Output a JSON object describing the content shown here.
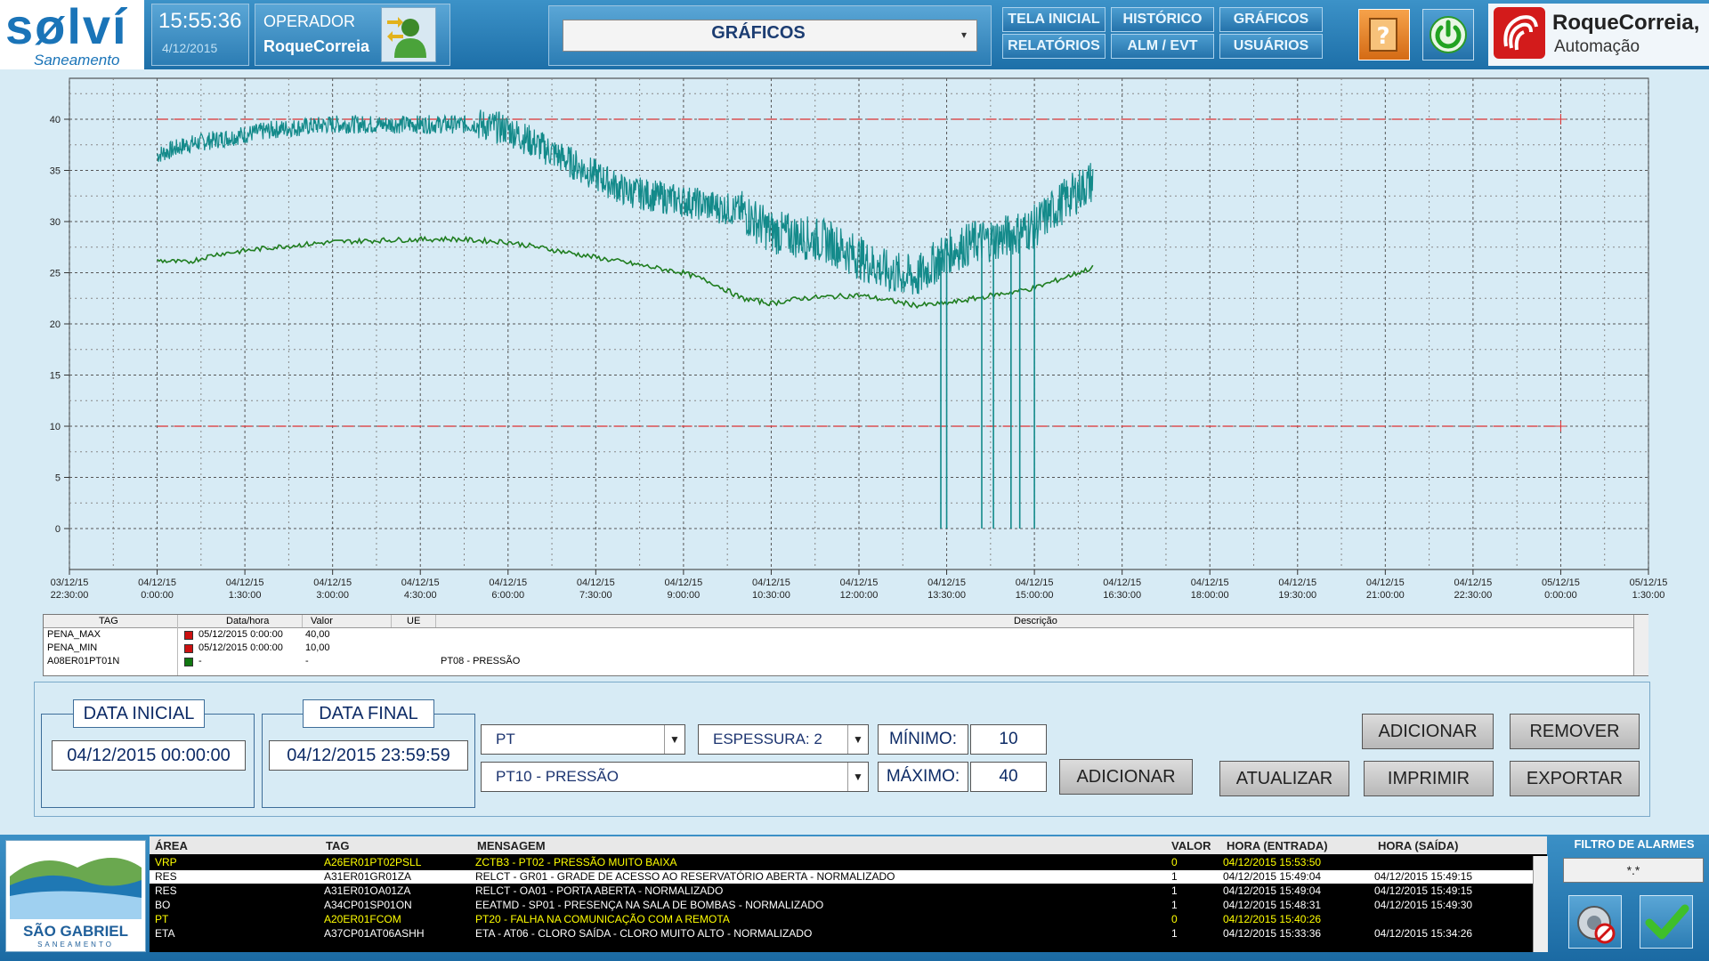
{
  "header": {
    "logo_text": "sølví",
    "logo_sub": "Saneamento",
    "clock": "15:55:36",
    "date_small": "4/12/2015",
    "operator_label": "OPERADOR",
    "operator_name": "RoqueCorreia",
    "screen_title": "GRÁFICOS",
    "nav": [
      "TELA INICIAL",
      "HISTÓRICO",
      "GRÁFICOS",
      "RELATÓRIOS",
      "ALM / EVT",
      "USUÁRIOS"
    ],
    "brand_name": "RoqueCorreia,",
    "brand_sub": "Automação",
    "icons": {
      "operator": "user-switch-icon",
      "help": "help-book-icon",
      "power": "power-icon"
    }
  },
  "chart_data": {
    "type": "line",
    "y_ticks": [
      "0",
      "5",
      "10",
      "15",
      "20",
      "25",
      "30",
      "35",
      "40"
    ],
    "ylim": [
      -4,
      44
    ],
    "x_ticks": [
      [
        "03/12/15",
        "22:30:00"
      ],
      [
        "04/12/15",
        "0:00:00"
      ],
      [
        "04/12/15",
        "1:30:00"
      ],
      [
        "04/12/15",
        "3:00:00"
      ],
      [
        "04/12/15",
        "4:30:00"
      ],
      [
        "04/12/15",
        "6:00:00"
      ],
      [
        "04/12/15",
        "7:30:00"
      ],
      [
        "04/12/15",
        "9:00:00"
      ],
      [
        "04/12/15",
        "10:30:00"
      ],
      [
        "04/12/15",
        "12:00:00"
      ],
      [
        "04/12/15",
        "13:30:00"
      ],
      [
        "04/12/15",
        "15:00:00"
      ],
      [
        "04/12/15",
        "16:30:00"
      ],
      [
        "04/12/15",
        "18:00:00"
      ],
      [
        "04/12/15",
        "19:30:00"
      ],
      [
        "04/12/15",
        "21:00:00"
      ],
      [
        "04/12/15",
        "22:30:00"
      ],
      [
        "05/12/15",
        "0:00:00"
      ],
      [
        "05/12/15",
        "1:30:00"
      ]
    ],
    "xlim_hours": [
      -1.5,
      25.5
    ],
    "grid": true,
    "series": [
      {
        "name": "PENA_MAX",
        "color": "#e03030",
        "style": "dashed",
        "x": [
          0,
          24
        ],
        "y": [
          40,
          40
        ]
      },
      {
        "name": "PENA_MIN",
        "color": "#e03030",
        "style": "dashed",
        "x": [
          0,
          24
        ],
        "y": [
          10,
          10
        ]
      },
      {
        "color": "#138a8a",
        "style": "noisy",
        "x": [
          0,
          0.5,
          1,
          2,
          3,
          4,
          5,
          5.5,
          6,
          6.5,
          7,
          7.5,
          8,
          9,
          10,
          10.5,
          11,
          11.5,
          12,
          12.5,
          13,
          13.5,
          14,
          14.5,
          15,
          15.5,
          16
        ],
        "y": [
          36.5,
          37.5,
          38,
          39,
          39.5,
          39.5,
          39.5,
          39.5,
          39,
          37.5,
          36,
          34.5,
          33,
          32,
          31,
          29,
          28.5,
          28,
          26.5,
          25,
          24.5,
          27,
          28,
          28.5,
          29.5,
          32,
          34
        ]
      },
      {
        "color": "#1f7d1f",
        "style": "line",
        "x": [
          0,
          0.5,
          1,
          2,
          3,
          4,
          5,
          6,
          7,
          8,
          9,
          9.5,
          10,
          10.5,
          11,
          12,
          13,
          13.5,
          14,
          15,
          16
        ],
        "y": [
          26.2,
          26,
          26.8,
          27.5,
          28,
          28.2,
          28.3,
          28,
          27,
          26,
          25,
          24,
          22.5,
          22,
          22.5,
          22.8,
          21.8,
          22,
          22.5,
          23.5,
          25.5
        ]
      }
    ],
    "spikes": {
      "x": [
        13.4,
        13.5,
        14.1,
        14.3,
        14.6,
        14.75,
        15.0
      ],
      "y_bottom": 0
    }
  },
  "legend_table": {
    "headers": [
      "TAG",
      "Data/hora",
      "Valor",
      "UE",
      "Descrição"
    ],
    "rows": [
      {
        "tag": "PENA_MAX",
        "color": "#cc1111",
        "date": "05/12/2015 0:00:00",
        "value": "40,00",
        "ue": "",
        "desc": ""
      },
      {
        "tag": "PENA_MIN",
        "color": "#cc1111",
        "date": "05/12/2015 0:00:00",
        "value": "10,00",
        "ue": "",
        "desc": ""
      },
      {
        "tag": "A08ER01PT01N",
        "color": "#117711",
        "date": "-",
        "value": "-",
        "ue": "",
        "desc": "PT08 - PRESSÃO"
      }
    ]
  },
  "controls": {
    "data_inicial_label": "DATA INICIAL",
    "data_inicial_value": "04/12/2015 00:00:00",
    "data_final_label": "DATA FINAL",
    "data_final_value": "04/12/2015 23:59:59",
    "type_select": "PT",
    "tag_select": "PT10 - PRESSÃO",
    "thickness_select": "ESPESSURA: 2",
    "min_label": "MÍNIMO:",
    "min_value": "10",
    "max_label": "MÁXIMO:",
    "max_value": "40",
    "buttons": {
      "adicionar_top": "ADICIONAR",
      "remover": "REMOVER",
      "adicionar": "ADICIONAR",
      "atualizar": "ATUALIZAR",
      "imprimir": "IMPRIMIR",
      "exportar": "EXPORTAR"
    }
  },
  "alarms": {
    "logo_title": "SÃO GABRIEL",
    "logo_sub": "SANEAMENTO",
    "headers": [
      "ÁREA",
      "TAG",
      "MENSAGEM",
      "VALOR",
      "HORA (ENTRADA)",
      "HORA (SAÍDA)"
    ],
    "filter_title": "FILTRO DE ALARMES",
    "filter_value": "*.*",
    "rows": [
      {
        "area": "VRP",
        "tag": "A26ER01PT02PSLL",
        "msg": "ZCTB3 - PT02 - PRESSÃO MUITO BAIXA",
        "valor": "0",
        "entrada": "04/12/2015 15:53:50",
        "saida": "",
        "fg": "#ffff00",
        "bg": "#000000"
      },
      {
        "area": "RES",
        "tag": "A31ER01GR01ZA",
        "msg": "RELCT - GR01 - GRADE DE ACESSO AO RESERVATÓRIO ABERTA - NORMALIZADO",
        "valor": "1",
        "entrada": "04/12/2015 15:49:04",
        "saida": "04/12/2015 15:49:15",
        "fg": "#000000",
        "bg": "#ffffff"
      },
      {
        "area": "RES",
        "tag": "A31ER01OA01ZA",
        "msg": "RELCT - OA01 - PORTA ABERTA - NORMALIZADO",
        "valor": "1",
        "entrada": "04/12/2015 15:49:04",
        "saida": "04/12/2015 15:49:15",
        "fg": "#ffffff",
        "bg": "#000000"
      },
      {
        "area": "BO",
        "tag": "A34CP01SP01ON",
        "msg": "EEATMD - SP01 - PRESENÇA NA SALA DE BOMBAS - NORMALIZADO",
        "valor": "1",
        "entrada": "04/12/2015 15:48:31",
        "saida": "04/12/2015 15:49:30",
        "fg": "#ffffff",
        "bg": "#000000"
      },
      {
        "area": "PT",
        "tag": "A20ER01FCOM",
        "msg": "PT20 - FALHA NA COMUNICAÇÃO COM A REMOTA",
        "valor": "0",
        "entrada": "04/12/2015 15:40:26",
        "saida": "",
        "fg": "#ffff00",
        "bg": "#000000"
      },
      {
        "area": "ETA",
        "tag": "A37CP01AT06ASHH",
        "msg": "ETA - AT06 - CLORO SAÍDA - CLORO MUITO ALTO - NORMALIZADO",
        "valor": "1",
        "entrada": "04/12/2015 15:33:36",
        "saida": "04/12/2015 15:34:26",
        "fg": "#ffffff",
        "bg": "#000000"
      }
    ]
  }
}
